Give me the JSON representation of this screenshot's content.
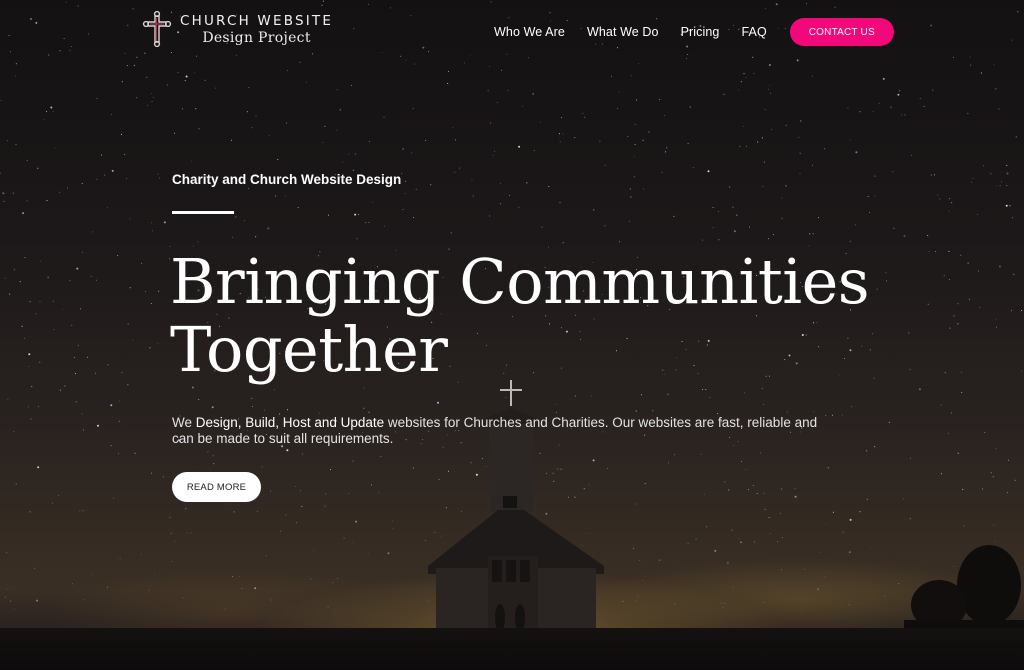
{
  "brand": {
    "line1": "CHURCH WEBSITE",
    "line2": "Design Project",
    "icon": "cross-icon"
  },
  "nav": {
    "links": [
      {
        "label": "Who We Are"
      },
      {
        "label": "What We Do"
      },
      {
        "label": "Pricing"
      },
      {
        "label": "FAQ"
      }
    ],
    "cta_label": "CONTACT US"
  },
  "hero": {
    "eyebrow": "Charity and Church Website Design",
    "headline_line1": "Bringing Communities",
    "headline_line2": "Together",
    "description": {
      "prefix": "We ",
      "emphasis": "Design, Build, Host and Update",
      "suffix": " websites for Churches and Charities. Our websites are fast, reliable and can be made to suit all requirements."
    },
    "button_label": "READ MORE",
    "background": "night-sky-church-photo"
  },
  "colors": {
    "accent": "#f2087a",
    "text": "#ffffff",
    "background": "#1a1616"
  }
}
